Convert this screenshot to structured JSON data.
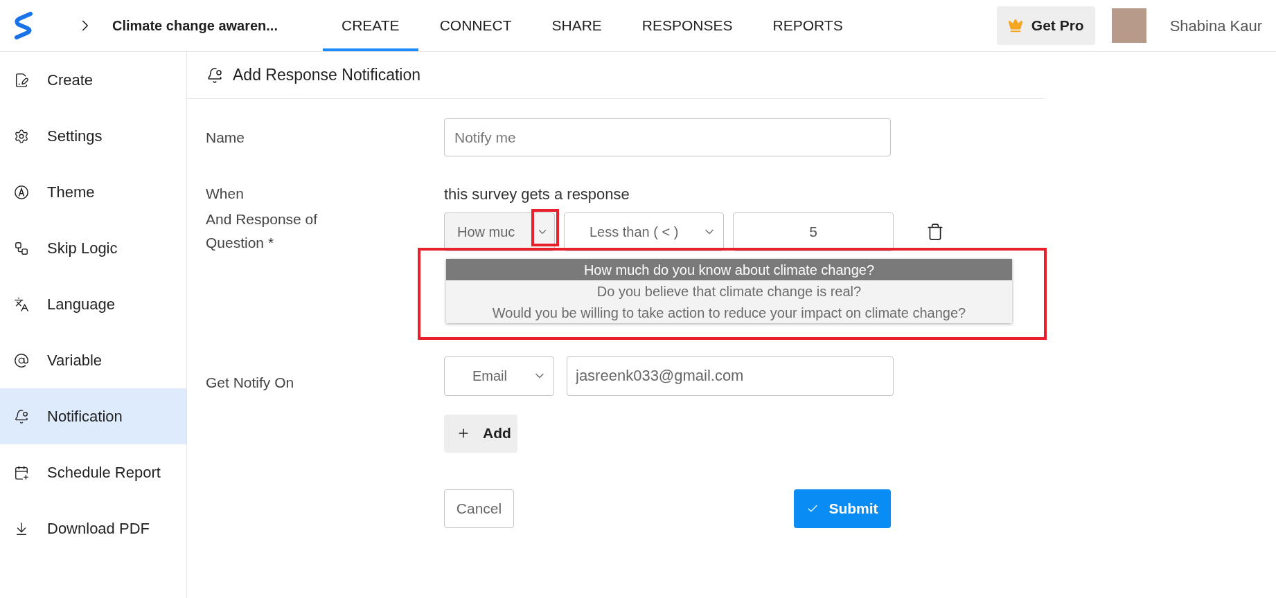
{
  "project_title": "Climate change awaren...",
  "tabs": [
    {
      "label": "CREATE",
      "selected": true
    },
    {
      "label": "CONNECT",
      "selected": false
    },
    {
      "label": "SHARE",
      "selected": false
    },
    {
      "label": "RESPONSES",
      "selected": false
    },
    {
      "label": "REPORTS",
      "selected": false
    }
  ],
  "pro_button": "Get Pro",
  "user": {
    "name": "Shabina Kaur"
  },
  "sidebar": {
    "items": [
      {
        "label": "Create",
        "selected": false
      },
      {
        "label": "Settings",
        "selected": false
      },
      {
        "label": "Theme",
        "selected": false
      },
      {
        "label": "Skip Logic",
        "selected": false
      },
      {
        "label": "Language",
        "selected": false
      },
      {
        "label": "Variable",
        "selected": false
      },
      {
        "label": "Notification",
        "selected": true
      },
      {
        "label": "Schedule Report",
        "selected": false
      },
      {
        "label": "Download PDF",
        "selected": false
      }
    ]
  },
  "panel": {
    "title": "Add Response Notification",
    "name_field": {
      "label": "Name",
      "placeholder": "Notify me"
    },
    "when": {
      "label": "When",
      "text": "this survey gets a response"
    },
    "condition": {
      "label": "And Response of Question *",
      "question": "How muc",
      "operator": "Less than ( < )",
      "value": "5"
    },
    "question_options": [
      {
        "label": "How much do you know about climate change?",
        "selected": true
      },
      {
        "label": "Do you believe that climate change is real?",
        "selected": false
      },
      {
        "label": "Would you be willing to take action to reduce your impact on climate change?",
        "selected": false
      }
    ],
    "notify": {
      "label": "Get Notify On",
      "channel": "Email",
      "address": "jasreenk033@gmail.com"
    },
    "add_button": "Add",
    "cancel_button": "Cancel",
    "submit_button": "Submit"
  }
}
